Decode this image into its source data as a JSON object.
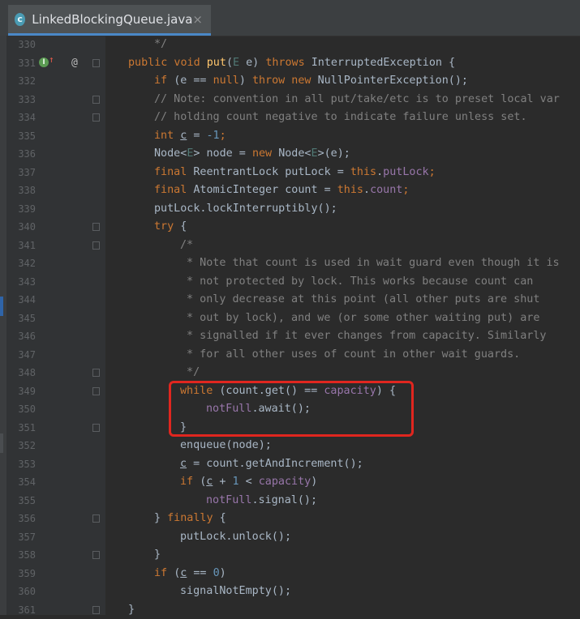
{
  "tab": {
    "title": "LinkedBlockingQueue.java",
    "close": "×",
    "icon_letter": "c"
  },
  "gutter_icons": {
    "override": "overridden-method-icon",
    "annotation": "@"
  },
  "lines": [
    {
      "n": "330",
      "indent": 1,
      "fold": false,
      "tokens": [
        [
          "cm",
          "*/"
        ]
      ]
    },
    {
      "n": "331",
      "indent": 0,
      "fold": true,
      "tokens": [
        [
          "kw",
          "public void "
        ],
        [
          "mt",
          "put"
        ],
        [
          "",
          "("
        ],
        [
          "tp",
          "E"
        ],
        [
          "",
          " e) "
        ],
        [
          "kw",
          "throws "
        ],
        [
          "",
          "InterruptedException {"
        ]
      ]
    },
    {
      "n": "332",
      "indent": 1,
      "fold": false,
      "tokens": [
        [
          "kw",
          "if "
        ],
        [
          "",
          "(e == "
        ],
        [
          "kw",
          "null"
        ],
        [
          "",
          ") "
        ],
        [
          "kw",
          "throw new "
        ],
        [
          "",
          "NullPointerException();"
        ]
      ]
    },
    {
      "n": "333",
      "indent": 1,
      "fold": true,
      "tokens": [
        [
          "cm",
          "// Note: convention in all put/take/etc is to preset local var"
        ]
      ]
    },
    {
      "n": "334",
      "indent": 1,
      "fold": true,
      "tokens": [
        [
          "cm",
          "// holding count negative to indicate failure unless set."
        ]
      ]
    },
    {
      "n": "335",
      "indent": 1,
      "fold": false,
      "tokens": [
        [
          "kw",
          "int "
        ],
        [
          "ul",
          "c"
        ],
        [
          "",
          " = "
        ],
        [
          "nm",
          "-1"
        ],
        [
          "kw",
          ";"
        ]
      ]
    },
    {
      "n": "336",
      "indent": 1,
      "fold": false,
      "tokens": [
        [
          "",
          "Node<"
        ],
        [
          "tp",
          "E"
        ],
        [
          "",
          "> node = "
        ],
        [
          "kw",
          "new "
        ],
        [
          "",
          "Node<"
        ],
        [
          "tp",
          "E"
        ],
        [
          "",
          ">(e);"
        ]
      ]
    },
    {
      "n": "337",
      "indent": 1,
      "fold": false,
      "tokens": [
        [
          "kw",
          "final "
        ],
        [
          "",
          "ReentrantLock putLock = "
        ],
        [
          "kw",
          "this"
        ],
        [
          "",
          "."
        ],
        [
          "fd",
          "putLock"
        ],
        [
          "kw",
          ";"
        ]
      ]
    },
    {
      "n": "338",
      "indent": 1,
      "fold": false,
      "tokens": [
        [
          "kw",
          "final "
        ],
        [
          "",
          "AtomicInteger count = "
        ],
        [
          "kw",
          "this"
        ],
        [
          "",
          "."
        ],
        [
          "fd",
          "count"
        ],
        [
          "kw",
          ";"
        ]
      ]
    },
    {
      "n": "339",
      "indent": 1,
      "fold": false,
      "tokens": [
        [
          "",
          "putLock.lockInterruptibly();"
        ]
      ]
    },
    {
      "n": "340",
      "indent": 1,
      "fold": true,
      "tokens": [
        [
          "kw",
          "try "
        ],
        [
          "",
          "{"
        ]
      ]
    },
    {
      "n": "341",
      "indent": 2,
      "fold": true,
      "tokens": [
        [
          "cm",
          "/*"
        ]
      ]
    },
    {
      "n": "342",
      "indent": 2,
      "fold": false,
      "tokens": [
        [
          "cm",
          " * Note that count is used in wait guard even though it is"
        ]
      ]
    },
    {
      "n": "343",
      "indent": 2,
      "fold": false,
      "tokens": [
        [
          "cm",
          " * not protected by lock. This works because count can"
        ]
      ]
    },
    {
      "n": "344",
      "indent": 2,
      "fold": false,
      "tokens": [
        [
          "cm",
          " * only decrease at this point (all other puts are shut"
        ]
      ]
    },
    {
      "n": "345",
      "indent": 2,
      "fold": false,
      "tokens": [
        [
          "cm",
          " * out by lock), and we (or some other waiting put) are"
        ]
      ]
    },
    {
      "n": "346",
      "indent": 2,
      "fold": false,
      "tokens": [
        [
          "cm",
          " * signalled if it ever changes from capacity. Similarly"
        ]
      ]
    },
    {
      "n": "347",
      "indent": 2,
      "fold": false,
      "tokens": [
        [
          "cm",
          " * for all other uses of count in other wait guards."
        ]
      ]
    },
    {
      "n": "348",
      "indent": 2,
      "fold": true,
      "tokens": [
        [
          "cm",
          " */"
        ]
      ]
    },
    {
      "n": "349",
      "indent": 2,
      "fold": true,
      "tokens": [
        [
          "kw",
          "while "
        ],
        [
          "",
          "(count.get() == "
        ],
        [
          "fd",
          "capacity"
        ],
        [
          "",
          ") {"
        ]
      ]
    },
    {
      "n": "350",
      "indent": 3,
      "fold": false,
      "tokens": [
        [
          "fd",
          "notFull"
        ],
        [
          "",
          ".await();"
        ]
      ]
    },
    {
      "n": "351",
      "indent": 2,
      "fold": true,
      "tokens": [
        [
          "",
          "}"
        ]
      ]
    },
    {
      "n": "352",
      "indent": 2,
      "fold": false,
      "tokens": [
        [
          "",
          "enqueue(node);"
        ]
      ]
    },
    {
      "n": "353",
      "indent": 2,
      "fold": false,
      "tokens": [
        [
          "ul",
          "c"
        ],
        [
          "",
          " = count.getAndIncrement();"
        ]
      ]
    },
    {
      "n": "354",
      "indent": 2,
      "fold": false,
      "tokens": [
        [
          "kw",
          "if "
        ],
        [
          "",
          "("
        ],
        [
          "ul",
          "c"
        ],
        [
          "",
          " + "
        ],
        [
          "nm",
          "1"
        ],
        [
          "",
          " < "
        ],
        [
          "fd",
          "capacity"
        ],
        [
          "",
          ")"
        ]
      ]
    },
    {
      "n": "355",
      "indent": 3,
      "fold": false,
      "tokens": [
        [
          "fd",
          "notFull"
        ],
        [
          "",
          ".signal();"
        ]
      ]
    },
    {
      "n": "356",
      "indent": 1,
      "fold": true,
      "tokens": [
        [
          "",
          "} "
        ],
        [
          "kw",
          "finally "
        ],
        [
          "",
          "{"
        ]
      ]
    },
    {
      "n": "357",
      "indent": 2,
      "fold": false,
      "tokens": [
        [
          "",
          "putLock.unlock();"
        ]
      ]
    },
    {
      "n": "358",
      "indent": 1,
      "fold": true,
      "tokens": [
        [
          "",
          "}"
        ]
      ]
    },
    {
      "n": "359",
      "indent": 1,
      "fold": false,
      "tokens": [
        [
          "kw",
          "if "
        ],
        [
          "",
          "("
        ],
        [
          "ul",
          "c"
        ],
        [
          "",
          " == "
        ],
        [
          "nm",
          "0"
        ],
        [
          "",
          ")"
        ]
      ]
    },
    {
      "n": "360",
      "indent": 2,
      "fold": false,
      "tokens": [
        [
          "",
          "signalNotEmpty();"
        ]
      ]
    },
    {
      "n": "361",
      "indent": 0,
      "fold": true,
      "tokens": [
        [
          "",
          "}"
        ]
      ]
    }
  ],
  "colors": {
    "editor_bg": "#2b2b2b",
    "gutter_bg": "#313335",
    "keyword": "#cc7832",
    "comment": "#808080",
    "field": "#9876aa",
    "number": "#6897bb",
    "method": "#ffc66d",
    "type_param": "#507874",
    "text": "#a9b7c6",
    "highlight_box": "#e0261f"
  }
}
